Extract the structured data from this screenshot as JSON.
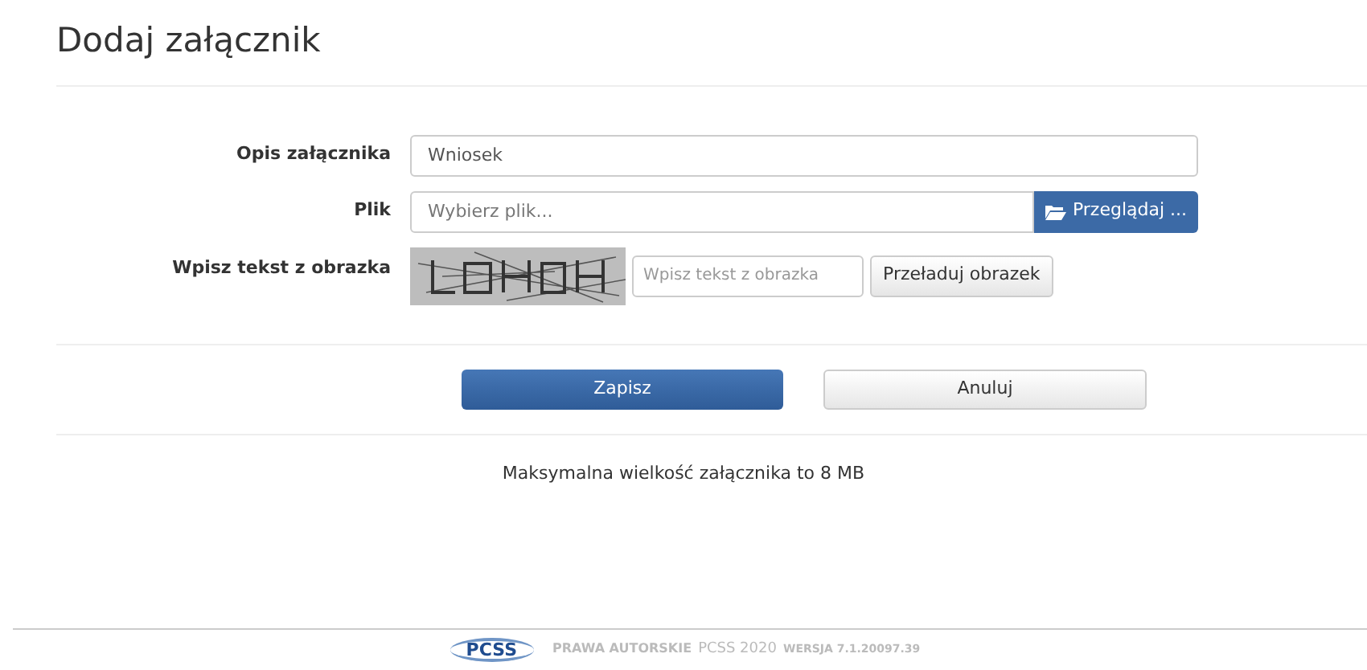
{
  "page_title": "Dodaj załącznik",
  "form": {
    "description": {
      "label": "Opis załącznika",
      "value": "Wniosek"
    },
    "file": {
      "label": "Plik",
      "placeholder": "Wybierz plik...",
      "browse_button": "Przeglądaj ..."
    },
    "captcha": {
      "label": "Wpisz tekst z obrazka",
      "placeholder": "Wpisz tekst z obrazka",
      "reload_button": "Przeładuj obrazek"
    }
  },
  "actions": {
    "save": "Zapisz",
    "cancel": "Anuluj"
  },
  "note": "Maksymalna wielkość załącznika to 8 MB",
  "footer": {
    "logo": "PCSS",
    "copyright_label": "PRAWA AUTORSKIE",
    "copyright_value": "PCSS 2020",
    "version": "WERSJA 7.1.20097.39"
  }
}
